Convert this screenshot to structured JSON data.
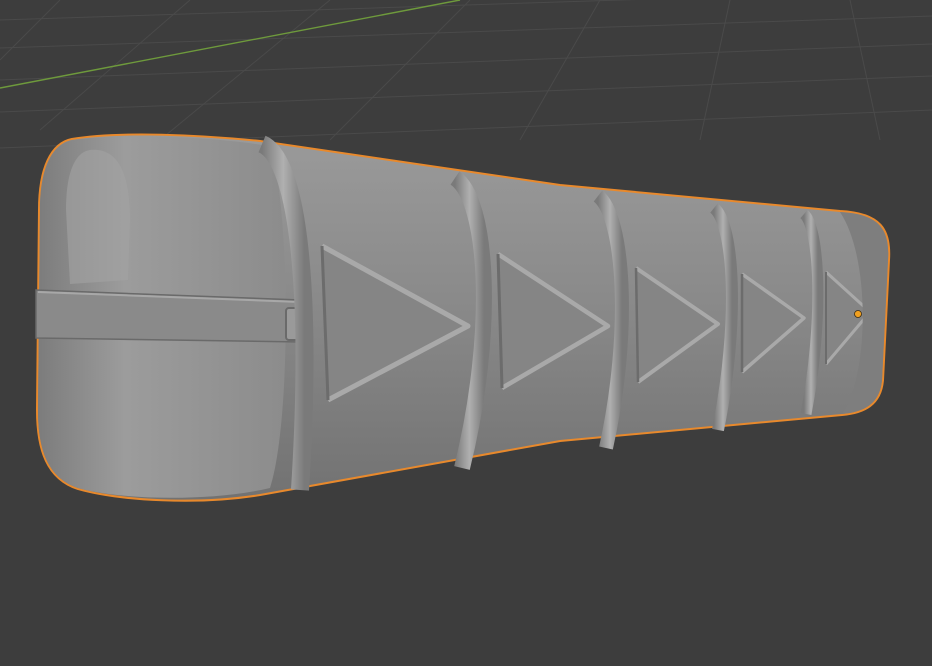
{
  "viewport": {
    "background_color": "#3d3d3d",
    "grid_color": "#4a4a4a",
    "x_axis_color": "#88b04a"
  },
  "selected_object": {
    "icon": "rounded-crate-mesh",
    "surface_color": "#8e8e8e",
    "surface_dark_color": "#6c6c6c",
    "surface_light_color": "#a9a9a9",
    "selection_outline_color": "#e8892c",
    "origin_dot_color": "#f0a020",
    "segment_count": 5,
    "triangle_decals": 5
  }
}
